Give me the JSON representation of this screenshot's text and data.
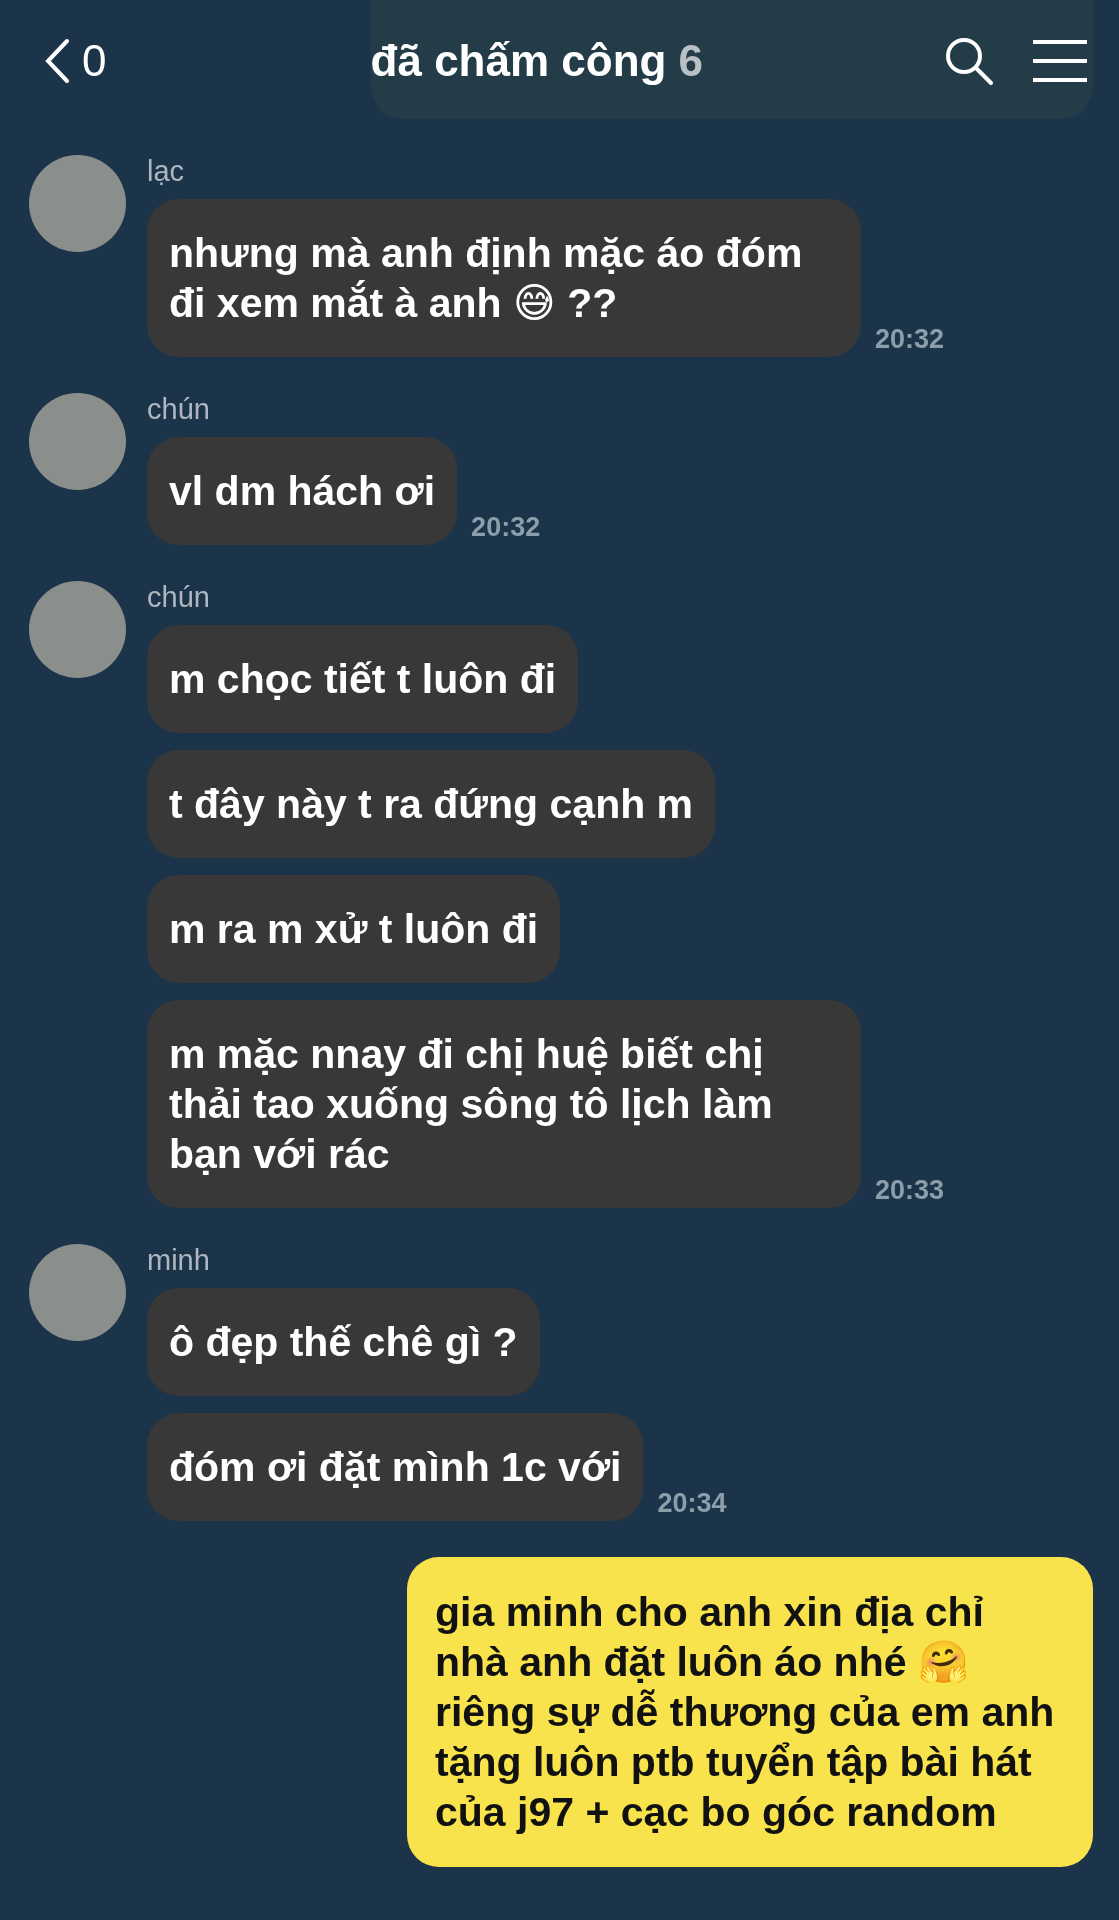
{
  "header": {
    "back_count": "0",
    "title": "đã chấm công",
    "member_count": "6"
  },
  "messages": [
    {
      "kind": "covered"
    },
    {
      "kind": "incoming",
      "sender": "lạc",
      "time": "20:32",
      "bubbles": [
        {
          "text": "nhưng mà anh định mặc áo đóm đi xem mắt à anh 😅 ??"
        }
      ]
    },
    {
      "kind": "incoming",
      "sender": "chún",
      "time": "20:32",
      "bubbles": [
        {
          "text": "vl dm hách ơi"
        }
      ]
    },
    {
      "kind": "incoming",
      "sender": "chún",
      "time": "20:33",
      "bubbles": [
        {
          "text": "m chọc tiết t luôn đi"
        },
        {
          "text": "t đây này t ra đứng cạnh m"
        },
        {
          "text": "m ra m xử t luôn đi"
        },
        {
          "text": "m mặc nnay đi chị huệ biết chị thải tao xuống sông tô lịch làm bạn với rác"
        }
      ]
    },
    {
      "kind": "incoming",
      "sender": "minh",
      "time": "20:34",
      "bubbles": [
        {
          "text": "ô đẹp thế chê gì ?"
        },
        {
          "text": "đóm ơi đặt mình 1c với"
        }
      ]
    },
    {
      "kind": "outgoing",
      "bubbles": [
        {
          "text": "gia minh cho anh xin địa chỉ nhà anh đặt luôn áo nhé 🤗 riêng sự dễ thương của em anh tặng luôn ptb tuyển tập bài hát của j97 + cạc bo góc random"
        }
      ]
    }
  ]
}
